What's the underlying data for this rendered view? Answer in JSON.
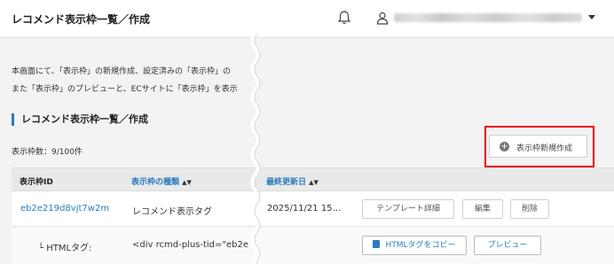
{
  "header": {
    "title": "レコメンド表示枠一覧／作成",
    "user_name": ""
  },
  "intro": {
    "line1": "本画面にて、「表示枠」の新規作成、設定済みの「表示枠」の",
    "line2": "また「表示枠」のプレビューと、ECサイトに「表示枠」を表示"
  },
  "section": {
    "title": "レコメンド表示枠一覧／作成",
    "count_label": "表示枠数：9/100件",
    "create_button": "表示枠新規作成"
  },
  "table": {
    "columns": {
      "id": "表示枠ID",
      "kind": "表示枠の種類",
      "updated": "最終更新日"
    },
    "rows": [
      {
        "id": "eb2e219d8vjt7w2m",
        "kind": "レコメンド表示タグ",
        "updated": "2025/11/21 15…",
        "actions": {
          "template_detail": "テンプレート詳細",
          "edit": "編集",
          "delete": "削除"
        }
      }
    ],
    "sub_row": {
      "label": "└ HTMLタグ:",
      "value": "<div rcmd-plus-tid=\"eb2e",
      "copy_button": "HTMLタグをコピー",
      "preview_button": "プレビュー"
    }
  },
  "colors": {
    "accent": "#2b7bc0",
    "highlight": "#e8000b",
    "header_bg": "#ffffff",
    "page_bg": "#f3f3f3"
  },
  "icons": {
    "notification": "bell-icon",
    "user": "user-icon",
    "menu": "caret-down-icon",
    "create": "plus-circle-icon",
    "copy": "copy-icon"
  }
}
